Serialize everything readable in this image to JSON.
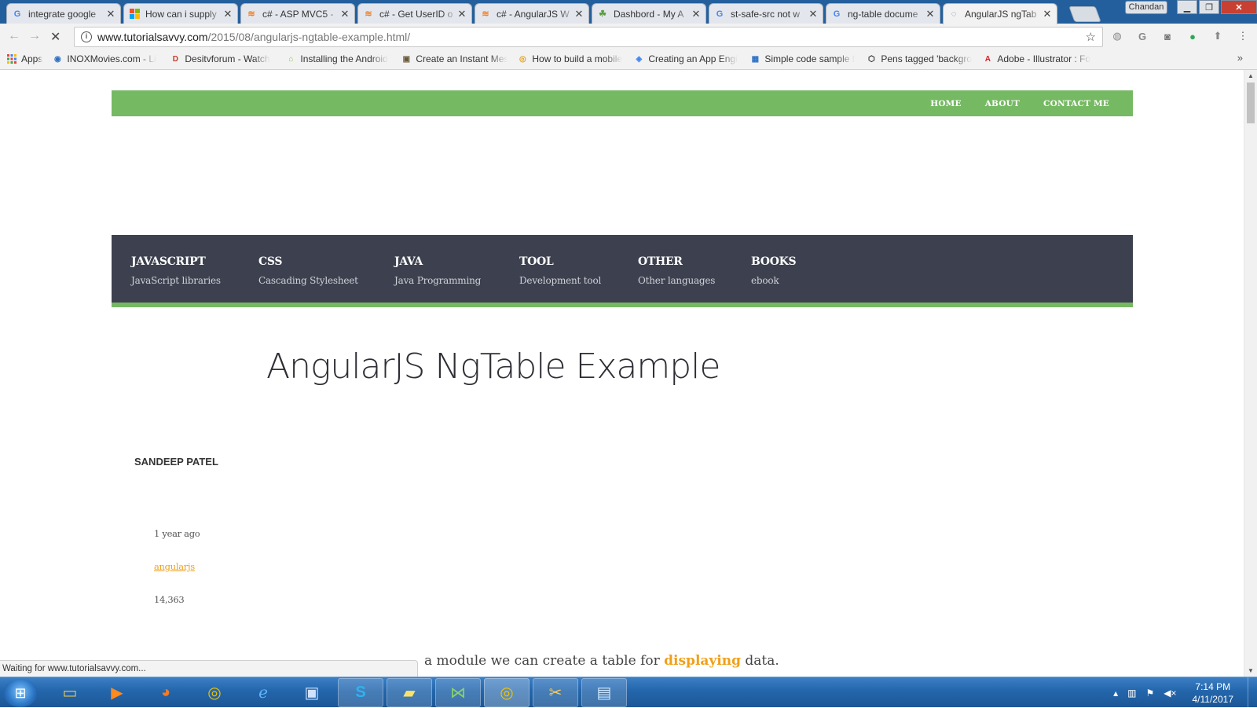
{
  "browser": {
    "tabs": [
      {
        "title": "integrate google",
        "icon": "google-icon"
      },
      {
        "title": "How can i supply",
        "icon": "microsoft-icon"
      },
      {
        "title": "c# - ASP MVC5 -",
        "icon": "stackoverflow-icon"
      },
      {
        "title": "c# - Get UserID o",
        "icon": "stackoverflow-icon"
      },
      {
        "title": "c# - AngularJS W",
        "icon": "stackoverflow-icon"
      },
      {
        "title": "Dashbord - My A",
        "icon": "dashboard-icon"
      },
      {
        "title": "st-safe-src not w",
        "icon": "google-icon"
      },
      {
        "title": "ng-table docume",
        "icon": "google-icon"
      },
      {
        "title": "AngularJS ngTab",
        "icon": "loading-icon"
      }
    ],
    "profile_name": "Chandan",
    "url_host": "www.tutorialsavvy.com",
    "url_path": "/2015/08/angularjs-ngtable-example.html/",
    "bookmarks": [
      {
        "title": "Apps",
        "icon": "apps-grid-icon"
      },
      {
        "title": "INOXMovies.com - Li",
        "icon": "globe-icon"
      },
      {
        "title": "Desitvforum - Watch",
        "icon": "desitv-icon"
      },
      {
        "title": "Installing the Android",
        "icon": "android-icon"
      },
      {
        "title": "Create an Instant Mes",
        "icon": "page-icon"
      },
      {
        "title": "How to build a mobile",
        "icon": "chrome-icon"
      },
      {
        "title": "Creating an App Engi",
        "icon": "appengine-icon"
      },
      {
        "title": "Simple code sample f",
        "icon": "grid-icon"
      },
      {
        "title": "Pens tagged 'backgro",
        "icon": "codepen-icon"
      },
      {
        "title": "Adobe - Illustrator : Fo",
        "icon": "adobe-icon"
      }
    ],
    "status_text": "Waiting for www.tutorialsavvy.com..."
  },
  "site": {
    "top_nav": [
      "HOME",
      "ABOUT",
      "CONTACT ME"
    ],
    "categories": [
      {
        "name": "JAVASCRIPT",
        "desc": "JavaScript libraries"
      },
      {
        "name": "CSS",
        "desc": "Cascading Stylesheet"
      },
      {
        "name": "JAVA",
        "desc": "Java Programming"
      },
      {
        "name": "TOOL",
        "desc": "Development tool"
      },
      {
        "name": "OTHER",
        "desc": "Other languages"
      },
      {
        "name": "BOOKS",
        "desc": "ebook"
      }
    ],
    "post": {
      "title": "AngularJS NgTable Example",
      "author": "SANDEEP PATEL",
      "date": "1 year ago",
      "tag": "angularjs",
      "views": "14,363",
      "intro_before": "a module we can create a table for ",
      "intro_highlight": "displaying",
      "intro_after": " data."
    },
    "colors": {
      "accent_green": "#76b963",
      "nav_dark": "#3d414f",
      "link_orange": "#f0a01a"
    }
  },
  "taskbar": {
    "apps": [
      "explorer-icon",
      "media-player-icon",
      "firefox-icon",
      "chrome-icon",
      "ie-icon",
      "network-icon",
      "skype-icon",
      "sticky-notes-icon",
      "visual-studio-icon",
      "chrome-icon",
      "snipping-tool-icon",
      "notepad-icon"
    ],
    "time": "7:14 PM",
    "date": "4/11/2017"
  }
}
